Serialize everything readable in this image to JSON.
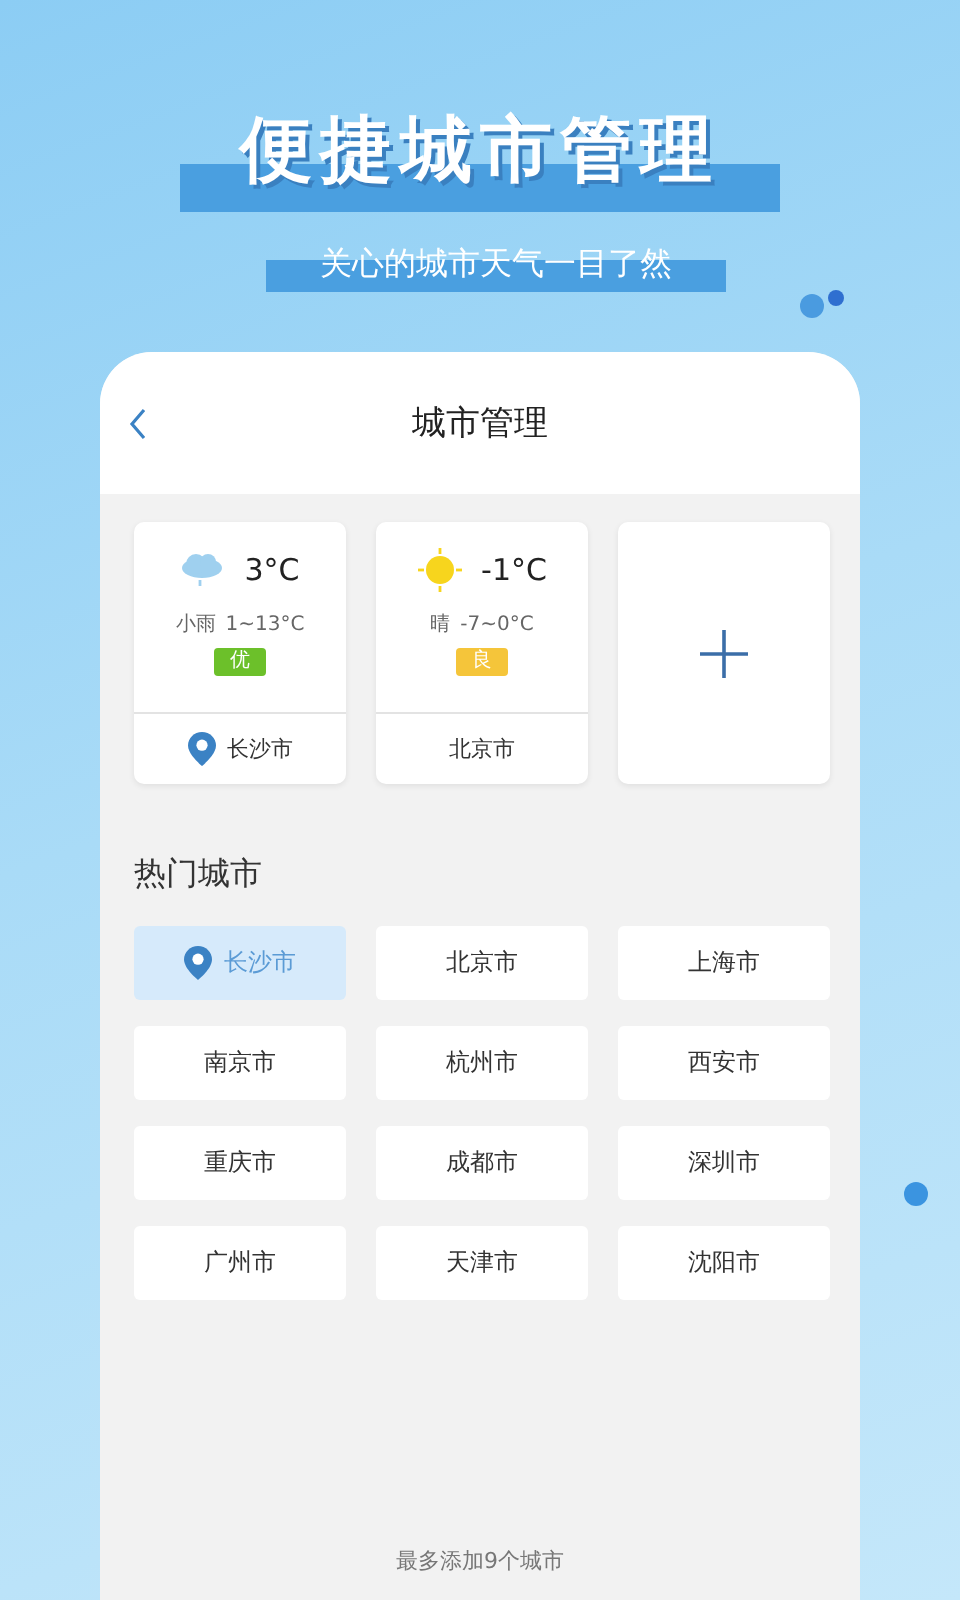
{
  "headline": "便捷城市管理",
  "subtitle": "关心的城市天气一目了然",
  "screen": {
    "title": "城市管理",
    "saved_cities": [
      {
        "kind": "rainy",
        "temperature": "3°C",
        "condition": "小雨",
        "range": "1~13°C",
        "air_quality": "优",
        "color": "#6cc02a",
        "city": "长沙市",
        "located": true
      },
      {
        "kind": "sunny",
        "temperature": "-1°C",
        "condition": "晴",
        "range": "-7~0°C",
        "air_quality": "良",
        "color": "#f5c53a",
        "city": "北京市",
        "located": false
      },
      {
        "kind": "add"
      }
    ],
    "hot_heading": "热门城市",
    "hot_cities": [
      {
        "name": "长沙市",
        "selected": true,
        "located": true
      },
      {
        "name": "北京市",
        "selected": false,
        "located": false
      },
      {
        "name": "上海市",
        "selected": false,
        "located": false
      },
      {
        "name": "南京市",
        "selected": false,
        "located": false
      },
      {
        "name": "杭州市",
        "selected": false,
        "located": false
      },
      {
        "name": "西安市",
        "selected": false,
        "located": false
      },
      {
        "name": "重庆市",
        "selected": false,
        "located": false
      },
      {
        "name": "成都市",
        "selected": false,
        "located": false
      },
      {
        "name": "深圳市",
        "selected": false,
        "located": false
      },
      {
        "name": "广州市",
        "selected": false,
        "located": false
      },
      {
        "name": "天津市",
        "selected": false,
        "located": false
      },
      {
        "name": "沈阳市",
        "selected": false,
        "located": false
      }
    ],
    "footer": "最多添加9个城市"
  }
}
